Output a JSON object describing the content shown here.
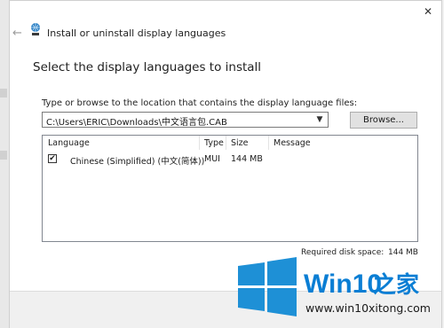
{
  "window": {
    "title": "Install or uninstall display languages",
    "close_glyph": "✕",
    "back_glyph": "←"
  },
  "main": {
    "heading": "Select the display languages to install",
    "path_label": "Type or browse to the location that contains the display language files:",
    "path_value": "C:\\Users\\ERIC\\Downloads\\中文语言包.CAB",
    "browse_label": "Browse..."
  },
  "table": {
    "headers": {
      "language": "Language",
      "type": "Type",
      "size": "Size",
      "message": "Message"
    },
    "rows": [
      {
        "checked": true,
        "check_glyph": "✔",
        "language": "Chinese (Simplified) (中文(简体))",
        "type": "MUI",
        "size": "144 MB",
        "message": ""
      }
    ]
  },
  "disk": {
    "label": "Required disk space:",
    "value": "144 MB"
  },
  "watermark": {
    "brand": "Win10",
    "brand_suffix": "之家",
    "url": "www.win10xitong.com"
  },
  "colors": {
    "accent": "#1e90d6",
    "brand": "#0a7ed4",
    "url": "#1a1a1a"
  }
}
